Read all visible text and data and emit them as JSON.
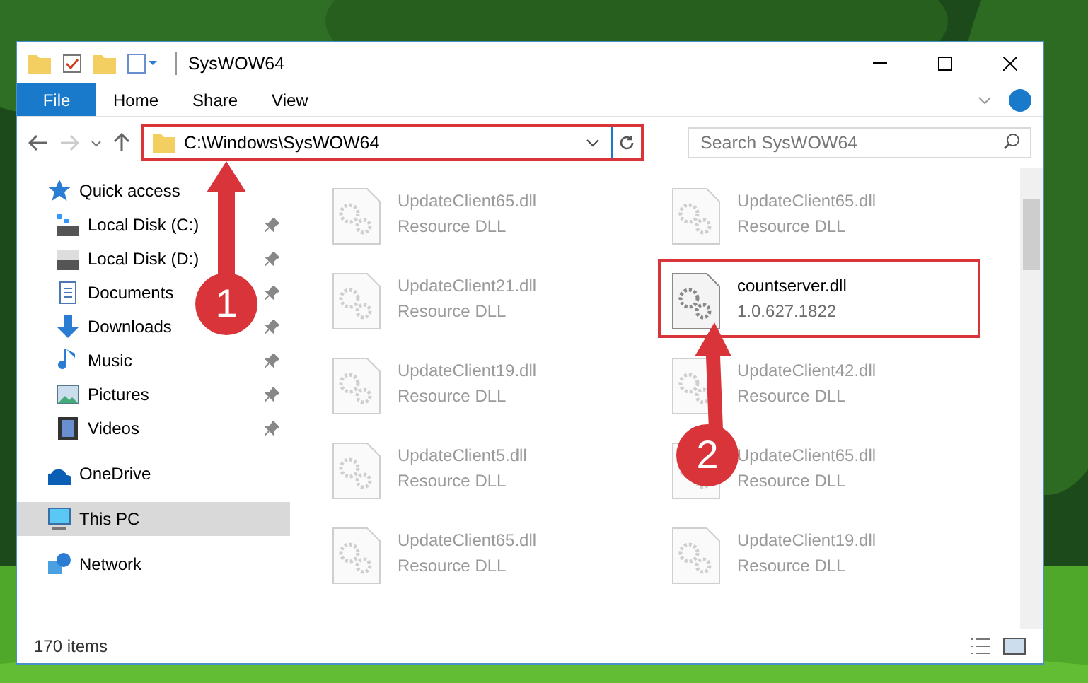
{
  "window": {
    "title": "SysWOW64"
  },
  "ribbon_tabs": [
    {
      "label": "File",
      "kind": "file"
    },
    {
      "label": "Home",
      "kind": "tab"
    },
    {
      "label": "Share",
      "kind": "tab"
    },
    {
      "label": "View",
      "kind": "tab"
    }
  ],
  "address": {
    "path": "C:\\Windows\\SysWOW64",
    "highlighted": true
  },
  "search": {
    "placeholder": "Search SysWOW64"
  },
  "sidebar": [
    {
      "label": "Quick access",
      "selected": false,
      "children": [
        {
          "label": "Local Disk (C:)",
          "pinned": true,
          "selected": false
        },
        {
          "label": "Local Disk (D:)",
          "pinned": true,
          "selected": false
        },
        {
          "label": "Documents",
          "pinned": true,
          "selected": false
        },
        {
          "label": "Downloads",
          "pinned": true,
          "selected": false
        },
        {
          "label": "Music",
          "pinned": true,
          "selected": false
        },
        {
          "label": "Pictures",
          "pinned": true,
          "selected": false
        },
        {
          "label": "Videos",
          "pinned": true,
          "selected": false
        }
      ]
    },
    {
      "label": "OneDrive",
      "selected": false
    },
    {
      "label": "This PC",
      "selected": true
    },
    {
      "label": "Network",
      "selected": false
    }
  ],
  "files": [
    {
      "name": "UpdateClient65.dll",
      "detail": "Resource DLL",
      "highlighted": false
    },
    {
      "name": "UpdateClient65.dll",
      "detail": "Resource DLL",
      "highlighted": false
    },
    {
      "name": "UpdateClient21.dll",
      "detail": "Resource DLL",
      "highlighted": false
    },
    {
      "name": "countserver.dll",
      "detail": "1.0.627.1822",
      "highlighted": true
    },
    {
      "name": "UpdateClient19.dll",
      "detail": "Resource DLL",
      "highlighted": false
    },
    {
      "name": "UpdateClient42.dll",
      "detail": "Resource DLL",
      "highlighted": false
    },
    {
      "name": "UpdateClient5.dll",
      "detail": "Resource DLL",
      "highlighted": false
    },
    {
      "name": "UpdateClient65.dll",
      "detail": "Resource DLL",
      "highlighted": false
    },
    {
      "name": "UpdateClient65.dll",
      "detail": "Resource DLL",
      "highlighted": false
    },
    {
      "name": "UpdateClient19.dll",
      "detail": "Resource DLL",
      "highlighted": false
    }
  ],
  "status_bar": {
    "count": "170 items"
  },
  "callouts": [
    {
      "number": "1"
    },
    {
      "number": "2"
    }
  ]
}
